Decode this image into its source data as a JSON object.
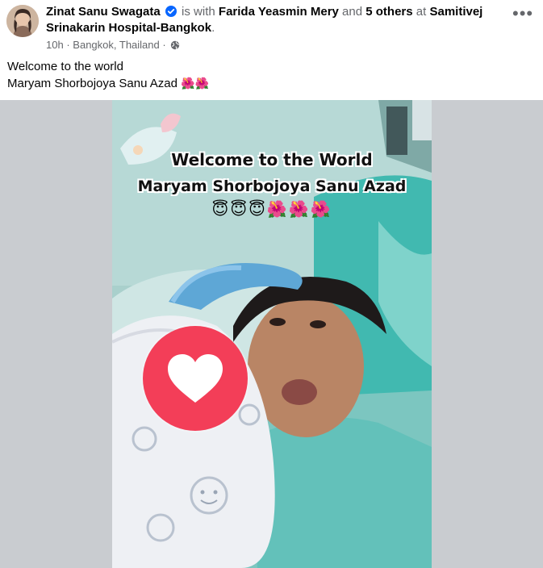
{
  "post": {
    "author": "Zinat Sanu Swagata",
    "is_with_text": "is with",
    "tagged_person": "Farida Yeasmin Mery",
    "and_text": "and",
    "others": "5 others",
    "at_text": "at",
    "location_name": "Samitivej Srinakarin Hospital-Bangkok",
    "period": ".",
    "time": "10h",
    "separator": "·",
    "place": "Bangkok, Thailand",
    "separator2": "·",
    "more_label": "•••",
    "caption_line1": "Welcome to the world",
    "caption_line2": "Maryam Shorbojoya Sanu Azad",
    "caption_emoji": "🌺🌺"
  },
  "photo": {
    "title_line1": "Welcome to the World",
    "title_line2": "Maryam Shorbojoya Sanu Azad",
    "emoji_line": "😇😇😇🌺🌺🌺"
  },
  "icons": {
    "avatar": "avatar",
    "verified": "verified-badge-icon",
    "privacy": "globe-icon",
    "more": "more-options-icon",
    "reaction": "love-reaction-icon"
  },
  "colors": {
    "verified": "#0866ff",
    "love": "#f33e58",
    "media_bg": "#c9ccd0"
  }
}
